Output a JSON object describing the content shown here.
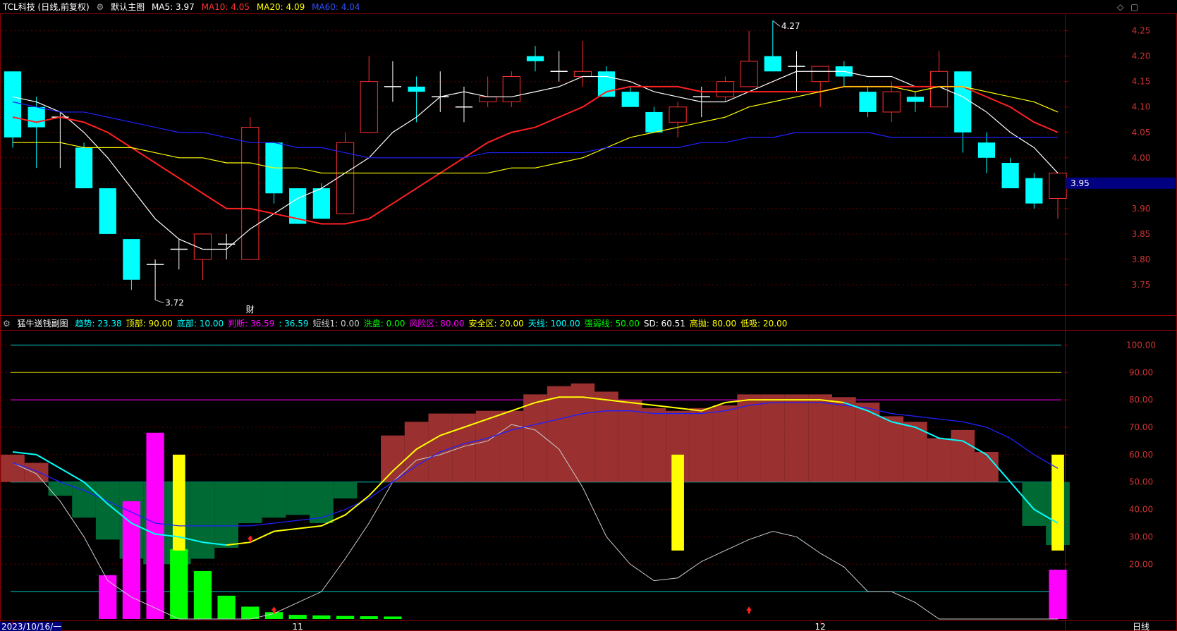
{
  "main_header": {
    "title": "TCL科技 (日线,前复权)",
    "template": "默认主图",
    "ma5_label": "MA5: 3.97",
    "ma10_label": "MA10: 4.05",
    "ma20_label": "MA20: 4.09",
    "ma60_label": "MA60: 4.04",
    "ma5_color": "#ffffff",
    "ma10_color": "#ff2020",
    "ma20_color": "#ffff00",
    "ma60_color": "#2020ff"
  },
  "sub_header": {
    "title": "猛牛送钱副图",
    "items": [
      {
        "text": "趋势: 23.38",
        "color": "#00ffff"
      },
      {
        "text": "顶部: 90.00",
        "color": "#ffff00"
      },
      {
        "text": "底部: 10.00",
        "color": "#00ffff"
      },
      {
        "text": "判断: 36.59",
        "color": "#ff00ff"
      },
      {
        "text": ": 36.59",
        "color": "#00ffff"
      },
      {
        "text": "短线1: 0.00",
        "color": "#cccccc"
      },
      {
        "text": "洗盘: 0.00",
        "color": "#00ff00"
      },
      {
        "text": "风险区: 80.00",
        "color": "#ff00ff"
      },
      {
        "text": "安全区: 20.00",
        "color": "#ffff00"
      },
      {
        "text": "天线: 100.00",
        "color": "#00ffff"
      },
      {
        "text": "强弱线: 50.00",
        "color": "#00ff00"
      },
      {
        "text": "SD: 60.51",
        "color": "#ffffff"
      },
      {
        "text": "高抛: 80.00",
        "color": "#ffff00"
      },
      {
        "text": "低吸: 20.00",
        "color": "#ffff00"
      }
    ]
  },
  "chart_data": [
    {
      "type": "candlestick",
      "title": "TCL科技 (日线,前复权)",
      "ylim": [
        3.7,
        4.28
      ],
      "y_ticks": [
        3.75,
        3.8,
        3.85,
        3.9,
        3.95,
        4.0,
        4.05,
        4.1,
        4.15,
        4.2,
        4.25
      ],
      "current_price_label": "3.95",
      "high_label": "4.27",
      "low_label": "3.72",
      "event_marker": "财",
      "candles": [
        {
          "o": 4.17,
          "h": 4.17,
          "l": 4.02,
          "c": 4.04
        },
        {
          "o": 4.1,
          "h": 4.12,
          "l": 3.98,
          "c": 4.06
        },
        {
          "o": 4.08,
          "h": 4.09,
          "l": 3.98,
          "c": 4.08
        },
        {
          "o": 4.02,
          "h": 4.03,
          "l": 3.94,
          "c": 3.94
        },
        {
          "o": 3.94,
          "h": 3.94,
          "l": 3.85,
          "c": 3.85
        },
        {
          "o": 3.84,
          "h": 3.84,
          "l": 3.74,
          "c": 3.76
        },
        {
          "o": 3.79,
          "h": 3.8,
          "l": 3.72,
          "c": 3.79
        },
        {
          "o": 3.82,
          "h": 3.84,
          "l": 3.78,
          "c": 3.82
        },
        {
          "o": 3.8,
          "h": 3.85,
          "l": 3.76,
          "c": 3.85
        },
        {
          "o": 3.83,
          "h": 3.85,
          "l": 3.8,
          "c": 3.83
        },
        {
          "o": 3.8,
          "h": 4.08,
          "l": 3.8,
          "c": 4.06
        },
        {
          "o": 4.03,
          "h": 4.03,
          "l": 3.91,
          "c": 3.93
        },
        {
          "o": 3.94,
          "h": 3.94,
          "l": 3.87,
          "c": 3.87
        },
        {
          "o": 3.94,
          "h": 3.95,
          "l": 3.88,
          "c": 3.88
        },
        {
          "o": 3.89,
          "h": 4.05,
          "l": 3.89,
          "c": 4.03
        },
        {
          "o": 4.05,
          "h": 4.2,
          "l": 4.05,
          "c": 4.15
        },
        {
          "o": 4.14,
          "h": 4.19,
          "l": 4.11,
          "c": 4.14
        },
        {
          "o": 4.14,
          "h": 4.16,
          "l": 4.07,
          "c": 4.13
        },
        {
          "o": 4.12,
          "h": 4.17,
          "l": 4.09,
          "c": 4.12
        },
        {
          "o": 4.1,
          "h": 4.14,
          "l": 4.07,
          "c": 4.1
        },
        {
          "o": 4.11,
          "h": 4.16,
          "l": 4.1,
          "c": 4.12
        },
        {
          "o": 4.11,
          "h": 4.17,
          "l": 4.1,
          "c": 4.16
        },
        {
          "o": 4.2,
          "h": 4.22,
          "l": 4.17,
          "c": 4.19
        },
        {
          "o": 4.17,
          "h": 4.21,
          "l": 4.15,
          "c": 4.17
        },
        {
          "o": 4.16,
          "h": 4.23,
          "l": 4.14,
          "c": 4.17
        },
        {
          "o": 4.17,
          "h": 4.18,
          "l": 4.12,
          "c": 4.12
        },
        {
          "o": 4.13,
          "h": 4.14,
          "l": 4.1,
          "c": 4.1
        },
        {
          "o": 4.09,
          "h": 4.1,
          "l": 4.05,
          "c": 4.05
        },
        {
          "o": 4.07,
          "h": 4.11,
          "l": 4.04,
          "c": 4.1
        },
        {
          "o": 4.12,
          "h": 4.14,
          "l": 4.08,
          "c": 4.12
        },
        {
          "o": 4.12,
          "h": 4.16,
          "l": 4.11,
          "c": 4.15
        },
        {
          "o": 4.14,
          "h": 4.25,
          "l": 4.14,
          "c": 4.19
        },
        {
          "o": 4.2,
          "h": 4.27,
          "l": 4.17,
          "c": 4.17
        },
        {
          "o": 4.18,
          "h": 4.21,
          "l": 4.13,
          "c": 4.18
        },
        {
          "o": 4.15,
          "h": 4.18,
          "l": 4.1,
          "c": 4.18
        },
        {
          "o": 4.18,
          "h": 4.19,
          "l": 4.14,
          "c": 4.16
        },
        {
          "o": 4.13,
          "h": 4.14,
          "l": 4.08,
          "c": 4.09
        },
        {
          "o": 4.09,
          "h": 4.15,
          "l": 4.07,
          "c": 4.13
        },
        {
          "o": 4.12,
          "h": 4.13,
          "l": 4.09,
          "c": 4.11
        },
        {
          "o": 4.1,
          "h": 4.21,
          "l": 4.1,
          "c": 4.17
        },
        {
          "o": 4.17,
          "h": 4.17,
          "l": 4.01,
          "c": 4.05
        },
        {
          "o": 4.03,
          "h": 4.05,
          "l": 3.97,
          "c": 4.0
        },
        {
          "o": 3.99,
          "h": 4.0,
          "l": 3.94,
          "c": 3.94
        },
        {
          "o": 3.96,
          "h": 3.97,
          "l": 3.9,
          "c": 3.91
        },
        {
          "o": 3.92,
          "h": 3.97,
          "l": 3.88,
          "c": 3.97
        }
      ],
      "series": [
        {
          "name": "MA5",
          "color": "#ffffff",
          "values": [
            4.12,
            4.11,
            4.09,
            4.05,
            4.0,
            3.94,
            3.88,
            3.84,
            3.82,
            3.82,
            3.86,
            3.89,
            3.92,
            3.94,
            3.97,
            4.0,
            4.05,
            4.08,
            4.12,
            4.13,
            4.12,
            4.12,
            4.13,
            4.14,
            4.16,
            4.16,
            4.15,
            4.13,
            4.12,
            4.11,
            4.11,
            4.13,
            4.15,
            4.17,
            4.17,
            4.17,
            4.16,
            4.16,
            4.14,
            4.14,
            4.12,
            4.09,
            4.05,
            4.02,
            3.97
          ]
        },
        {
          "name": "MA10",
          "color": "#ff2020",
          "values": [
            4.08,
            4.07,
            4.08,
            4.07,
            4.05,
            4.02,
            3.99,
            3.96,
            3.93,
            3.9,
            3.9,
            3.89,
            3.88,
            3.87,
            3.87,
            3.88,
            3.91,
            3.94,
            3.97,
            4.0,
            4.03,
            4.05,
            4.06,
            4.08,
            4.1,
            4.13,
            4.14,
            4.14,
            4.14,
            4.13,
            4.13,
            4.13,
            4.13,
            4.13,
            4.13,
            4.14,
            4.14,
            4.14,
            4.14,
            4.14,
            4.14,
            4.12,
            4.1,
            4.07,
            4.05
          ]
        },
        {
          "name": "MA20",
          "color": "#ffff00",
          "values": [
            4.03,
            4.03,
            4.03,
            4.02,
            4.02,
            4.02,
            4.01,
            4.0,
            4.0,
            3.99,
            3.99,
            3.98,
            3.98,
            3.97,
            3.97,
            3.97,
            3.97,
            3.97,
            3.97,
            3.97,
            3.97,
            3.98,
            3.98,
            3.99,
            4.0,
            4.02,
            4.04,
            4.05,
            4.06,
            4.07,
            4.08,
            4.1,
            4.11,
            4.12,
            4.13,
            4.14,
            4.14,
            4.14,
            4.13,
            4.14,
            4.14,
            4.13,
            4.12,
            4.11,
            4.09
          ]
        },
        {
          "name": "MA60",
          "color": "#2020ff",
          "values": [
            4.11,
            4.1,
            4.09,
            4.09,
            4.08,
            4.07,
            4.06,
            4.05,
            4.05,
            4.04,
            4.03,
            4.03,
            4.02,
            4.02,
            4.01,
            4.0,
            4.0,
            4.0,
            4.0,
            4.0,
            4.01,
            4.01,
            4.01,
            4.01,
            4.01,
            4.02,
            4.02,
            4.02,
            4.02,
            4.03,
            4.03,
            4.04,
            4.04,
            4.05,
            4.05,
            4.05,
            4.05,
            4.04,
            4.04,
            4.04,
            4.04,
            4.04,
            4.04,
            4.04,
            4.04
          ]
        }
      ]
    },
    {
      "type": "bar",
      "title": "猛牛送钱副图",
      "ylim": [
        0,
        105
      ],
      "y_ticks": [
        20,
        30,
        40,
        50,
        60,
        70,
        80,
        90,
        100
      ],
      "reference_lines": [
        {
          "value": 100,
          "color": "#00cccc"
        },
        {
          "value": 90,
          "color": "#cccc00"
        },
        {
          "value": 80,
          "color": "#ff00ff"
        },
        {
          "value": 50,
          "color": "#00cccc"
        },
        {
          "value": 10,
          "color": "#00cccc"
        }
      ],
      "area_values": [
        60,
        57,
        45,
        37,
        29,
        22,
        20,
        20,
        22,
        26,
        35,
        37,
        38,
        35,
        44,
        50,
        67,
        72,
        75,
        75,
        76,
        76,
        82,
        85,
        86,
        83,
        80,
        77,
        76,
        77,
        78,
        82,
        82,
        82,
        82,
        81,
        79,
        74,
        72,
        66,
        69,
        61,
        50,
        34,
        27
      ],
      "trend_line": [
        61,
        60,
        55,
        50,
        42,
        35,
        31,
        30,
        28,
        27,
        28,
        32,
        33,
        34,
        38,
        45,
        54,
        62,
        67,
        70,
        73,
        76,
        79,
        81,
        81,
        80,
        79,
        78,
        77,
        76,
        79,
        80,
        80,
        80,
        80,
        79,
        76,
        72,
        70,
        66,
        65,
        60,
        50,
        40,
        35
      ],
      "judge_line": [
        57,
        54,
        50,
        47,
        43,
        39,
        35,
        34,
        34,
        34,
        34,
        35,
        36,
        37,
        40,
        44,
        50,
        56,
        61,
        64,
        66,
        69,
        71,
        73,
        75,
        76,
        76,
        75,
        75,
        75,
        76,
        78,
        79,
        79,
        79,
        78,
        77,
        75,
        74,
        73,
        72,
        70,
        66,
        60,
        55
      ],
      "sd_line": [
        57,
        53,
        43,
        30,
        14,
        8,
        4,
        0,
        0,
        0,
        0,
        2,
        6,
        10,
        22,
        35,
        50,
        58,
        60,
        63,
        65,
        71,
        69,
        62,
        48,
        30,
        20,
        14,
        15,
        21,
        25,
        29,
        32,
        30,
        24,
        19,
        10,
        10,
        6,
        0,
        0,
        0,
        0,
        0,
        0
      ],
      "magenta_bars": [
        {
          "i": 4,
          "v": 16
        },
        {
          "i": 5,
          "v": 43
        },
        {
          "i": 6,
          "v": 68
        },
        {
          "i": 44,
          "v": 18
        }
      ],
      "green_bars": [
        {
          "i": 7,
          "v": 25
        },
        {
          "i": 8,
          "v": 17
        },
        {
          "i": 9,
          "v": 8
        },
        {
          "i": 10,
          "v": 4
        },
        {
          "i": 11,
          "v": 2
        },
        {
          "i": 12,
          "v": 1
        },
        {
          "i": 13,
          "v": 0.8
        },
        {
          "i": 14,
          "v": 0.6
        },
        {
          "i": 15,
          "v": 0.5
        },
        {
          "i": 16,
          "v": 0.4
        }
      ],
      "yellow_bars": [
        {
          "i": 7,
          "from": 25,
          "to": 60
        },
        {
          "i": 28,
          "from": 25,
          "to": 60
        },
        {
          "i": 44,
          "from": 25,
          "to": 60
        }
      ],
      "up_arrows": [
        10,
        11,
        31
      ]
    }
  ],
  "x_axis": {
    "labels": [
      {
        "i": 0,
        "text": "2023/10/16/一"
      },
      {
        "i": 12,
        "text": "11"
      },
      {
        "i": 34,
        "text": "12"
      }
    ],
    "period": "日线"
  }
}
